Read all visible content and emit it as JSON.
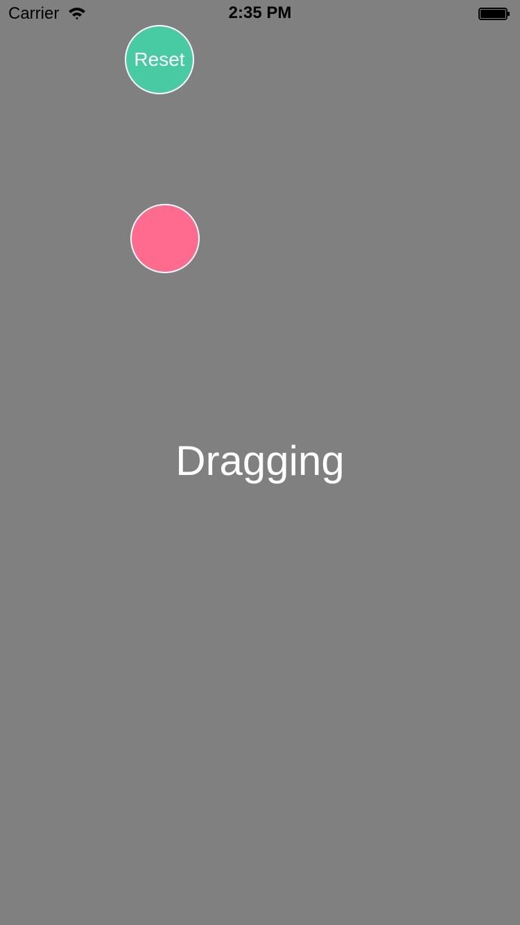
{
  "status_bar": {
    "carrier": "Carrier",
    "time": "2:35 PM",
    "wifi_icon": "wifi-icon",
    "battery_icon": "battery-icon",
    "battery_level": 1.0
  },
  "reset_button": {
    "label": "Reset",
    "color": "#48cba3"
  },
  "drag_ball": {
    "color": "#ff6b8e"
  },
  "main": {
    "status_text": "Dragging"
  },
  "colors": {
    "background": "#808080",
    "outline": "#ffffff"
  }
}
